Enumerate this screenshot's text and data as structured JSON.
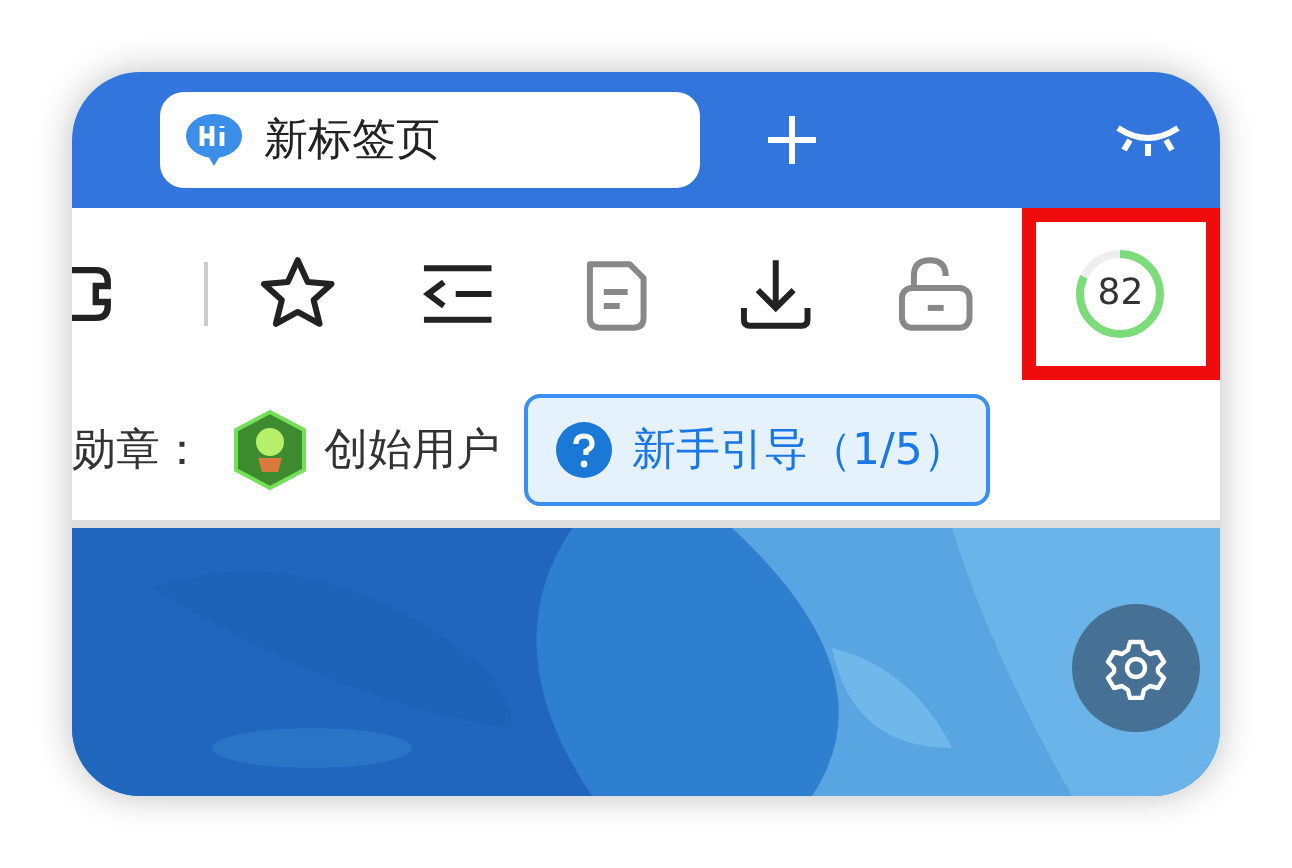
{
  "tab": {
    "title": "新标签页",
    "selected": true
  },
  "score": {
    "value": "82",
    "level": 0.82,
    "highlighted": true
  },
  "badge_row": {
    "label": "勋章：",
    "badge_name": "创始用户"
  },
  "guide_button": {
    "label": "新手引导（1/5）"
  }
}
